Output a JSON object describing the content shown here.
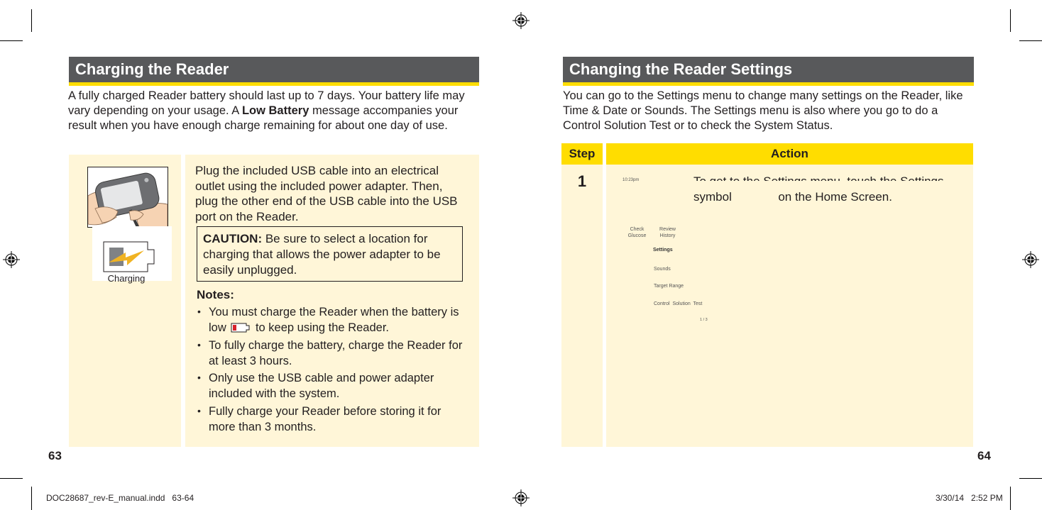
{
  "left_page": {
    "title": "Charging the Reader",
    "intro": {
      "part1": "A fully charged  Reader battery should last up to 7 days. Your battery life may vary depending  on your usage. A ",
      "bold": "Low Battery",
      "part2": "  message accompanies your result when you have enough  charge remaining  for about one day of use."
    },
    "instruction": "Plug the included USB cable  into an electrical outlet using the included power adapter. Then, plug the other end of the USB cable  into the USB port on the Reader.",
    "caution": {
      "label": "CAUTION:",
      "text": " Be sure to select a location  for charging that allows the power adapter to be easily unplugged."
    },
    "charging_label": "Charging",
    "notes_title": "Notes:",
    "notes": [
      {
        "before": "You must  charge  the Reader when  the battery is low ",
        "after": " to keep using the Reader."
      },
      {
        "before": "To fully charge the battery, charge the Reader for at least 3 hours.",
        "after": ""
      },
      {
        "before": "Only  use the USB cable and power  adapter included with the system.",
        "after": ""
      },
      {
        "before": "Fully charge  your  Reader before  storing  it for more than 3 months.",
        "after": ""
      }
    ],
    "page_number": "63",
    "icons": {
      "low_battery_fill": "#d7222a",
      "charging_bolt": "#f0b323"
    }
  },
  "right_page": {
    "title": "Changing the Reader Settings",
    "intro": "You can go to the Settings menu to change many settings on the Reader, like Time & Date or Sounds. The Settings menu  is also where  you go to do a Control  Solution Test or to check the System Status.",
    "table": {
      "headers": [
        "Step",
        "Action"
      ],
      "rows": [
        {
          "step": "1",
          "action_line1": "To get to the Settings menu, touch the Settings",
          "action_line2_a": "symbol",
          "action_line2_b": "on the Home Screen.",
          "screen": {
            "time": "10:23pm",
            "home_buttons": [
              "Check\nGlucose",
              "Review\nHistory"
            ],
            "menu_title": "Settings",
            "menu_items": [
              "Sounds",
              "Target Range",
              "Control  Solution  Test"
            ],
            "pager": "1 / 3"
          }
        }
      ]
    },
    "page_number": "64"
  },
  "slug": {
    "file": "DOC28687_rev-E_manual.indd   63-64",
    "timestamp": "3/30/14   2:52 PM"
  },
  "colors": {
    "header_bar": "#58595b",
    "accent_yellow": "#ffdd00",
    "panel_cream": "#fff6d8"
  }
}
